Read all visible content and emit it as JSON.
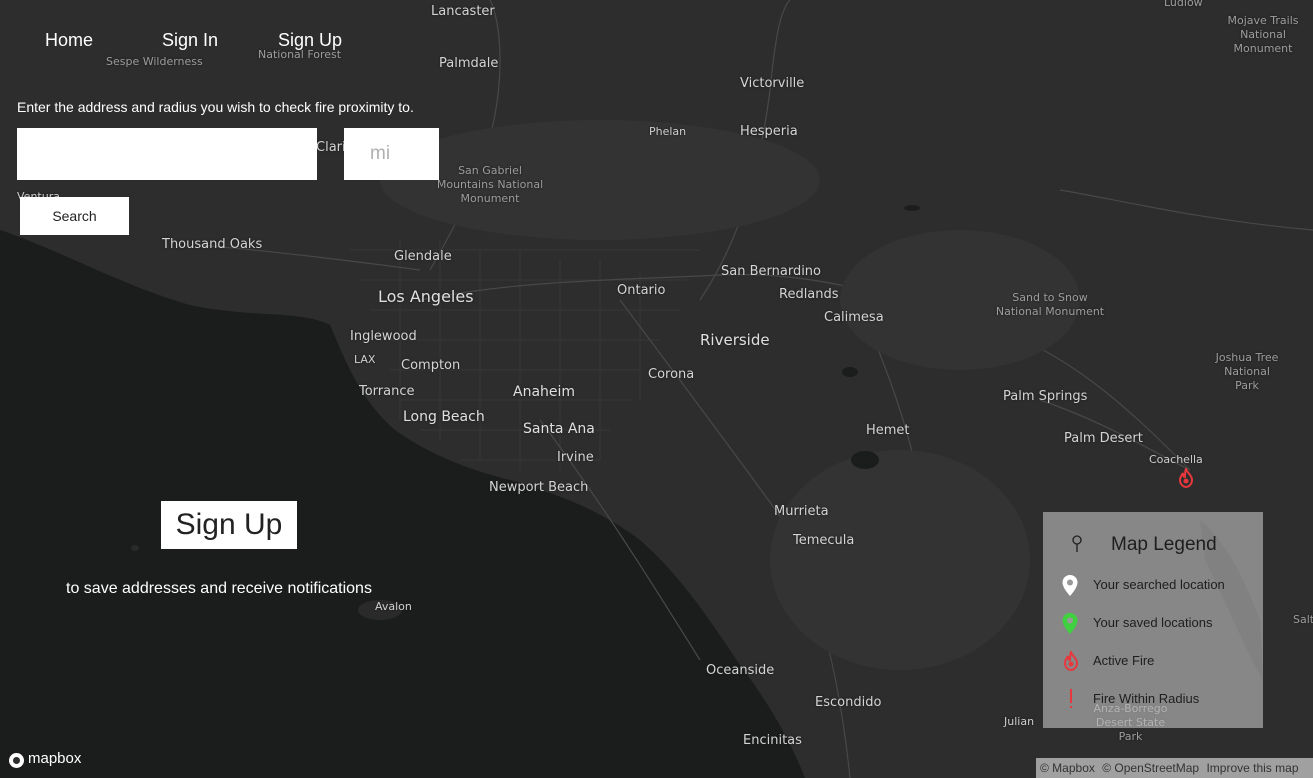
{
  "nav": {
    "home": "Home",
    "sign_in": "Sign In",
    "sign_up": "Sign Up"
  },
  "search": {
    "instruction": "Enter the address and radius you wish to check fire proximity to.",
    "address_value": "",
    "radius_placeholder": "mi",
    "button_label": "Search"
  },
  "signup_promo": {
    "button_label": "Sign Up",
    "note": "to save addresses and receive notifications"
  },
  "legend": {
    "title": "Map Legend",
    "items": [
      {
        "label": "Your searched location",
        "icon": "white-pin-icon",
        "color": "#ffffff"
      },
      {
        "label": "Your saved locations",
        "icon": "green-pin-icon",
        "color": "#3fd13f"
      },
      {
        "label": "Active Fire",
        "icon": "fire-icon",
        "color": "#e8383d"
      },
      {
        "label": "Fire Within Radius",
        "icon": "exclamation-icon",
        "color": "#e8383d"
      }
    ]
  },
  "map": {
    "labels": [
      "Lancaster",
      "Sespe Wilderness",
      "National Forest",
      "Palmdale",
      "Victorville",
      "Phelan",
      "Hesperia",
      "Clari",
      "San Gabriel Mountains National Monument",
      "Ventura",
      "Thousand Oaks",
      "Glendale",
      "Los Angeles",
      "Ontario",
      "San Bernardino",
      "Redlands",
      "Calimesa",
      "Inglewood",
      "LAX",
      "Compton",
      "Torrance",
      "Anaheim",
      "Long Beach",
      "Santa Ana",
      "Irvine",
      "Corona",
      "Riverside",
      "Newport Beach",
      "Hemet",
      "Murrieta",
      "Temecula",
      "Avalon",
      "Oceanside",
      "Escondido",
      "Encinitas",
      "Julian",
      "Sand to Snow National Monument",
      "Joshua Tree National Park",
      "Palm Springs",
      "Palm Desert",
      "Coachella",
      "Mojave Trails National Monument",
      "Ludlow",
      "Anza-Borrego Desert State Park",
      "Salt"
    ]
  },
  "attribution": {
    "mapbox": "© Mapbox",
    "osm": "© OpenStreetMap",
    "improve": "Improve this map"
  },
  "logo": {
    "text": "mapbox"
  }
}
